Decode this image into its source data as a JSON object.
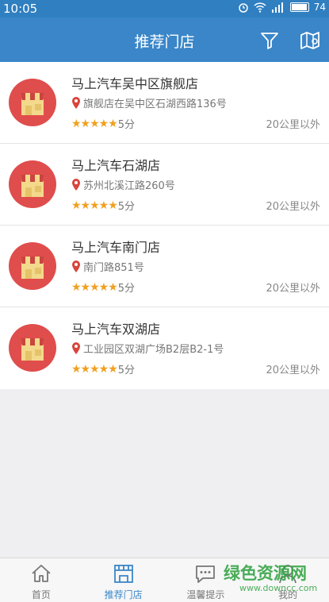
{
  "status": {
    "time": "10:05",
    "battery": "74"
  },
  "header": {
    "title": "推荐门店"
  },
  "stores": [
    {
      "name": "马上汽车吴中区旗舰店",
      "address": "旗舰店在吴中区石湖西路136号",
      "stars": "★★★★★",
      "score": "5分",
      "distance": "20公里以外"
    },
    {
      "name": "马上汽车石湖店",
      "address": "苏州北溪江路260号",
      "stars": "★★★★★",
      "score": "5分",
      "distance": "20公里以外"
    },
    {
      "name": "马上汽车南门店",
      "address": "南门路851号",
      "stars": "★★★★★",
      "score": "5分",
      "distance": "20公里以外"
    },
    {
      "name": "马上汽车双湖店",
      "address": "工业园区双湖广场B2层B2-1号",
      "stars": "★★★★★",
      "score": "5分",
      "distance": "20公里以外"
    }
  ],
  "tabs": [
    {
      "label": "首页",
      "icon": "home-icon"
    },
    {
      "label": "推荐门店",
      "icon": "store-icon"
    },
    {
      "label": "温馨提示",
      "icon": "message-icon"
    },
    {
      "label": "我的",
      "icon": "user-icon"
    }
  ],
  "watermark": {
    "logo": "绿色资源网",
    "url": "www.downcc.com"
  },
  "colors": {
    "accent": "#3a86c8",
    "logo_bg": "#e04d4d",
    "star": "#f0a020"
  }
}
